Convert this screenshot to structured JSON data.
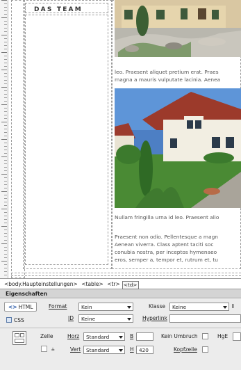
{
  "canvas": {
    "team_heading": "DAS TEAM",
    "para1_line1": "leo. Praesent aliquet pretium erat. Praes",
    "para1_line2": "magna a mauris vulputate lacinia. Aenea",
    "para2_line1": "Nullam fringilla urna id leo. Praesent alio",
    "para3_lines": [
      "Praesent non odio. Pellentesque a magn",
      "Aenean viverra. Class aptent taciti soc",
      "conubia nostra, per inceptos hymenaeo",
      "eros, semper a, tempor et, rutrum et, tu"
    ]
  },
  "tag_selector": {
    "tags": [
      "<body.Haupteinstellungen>",
      "<table>",
      "<tr>",
      "<td>"
    ]
  },
  "properties": {
    "title": "Eigenschaften",
    "html_button": "HTML",
    "css_button": "CSS",
    "format_label": "Format",
    "format_value": "Kein",
    "id_label": "ID",
    "id_value": "Keine",
    "klasse_label": "Klasse",
    "klasse_value": "Keine",
    "hyperlink_label": "Hyperlink",
    "zelle_label": "Zelle",
    "horz_label": "Horz",
    "horz_value": "Standard",
    "vert_label": "Vert",
    "vert_value": "Standard",
    "b_label": "B",
    "b_value": "",
    "h_label": "H",
    "h_value": "420",
    "kein_umbruch_label": "Kein Umbruch",
    "kopfzeile_label": "Kopfzeile",
    "hgt_label": "HgE"
  }
}
